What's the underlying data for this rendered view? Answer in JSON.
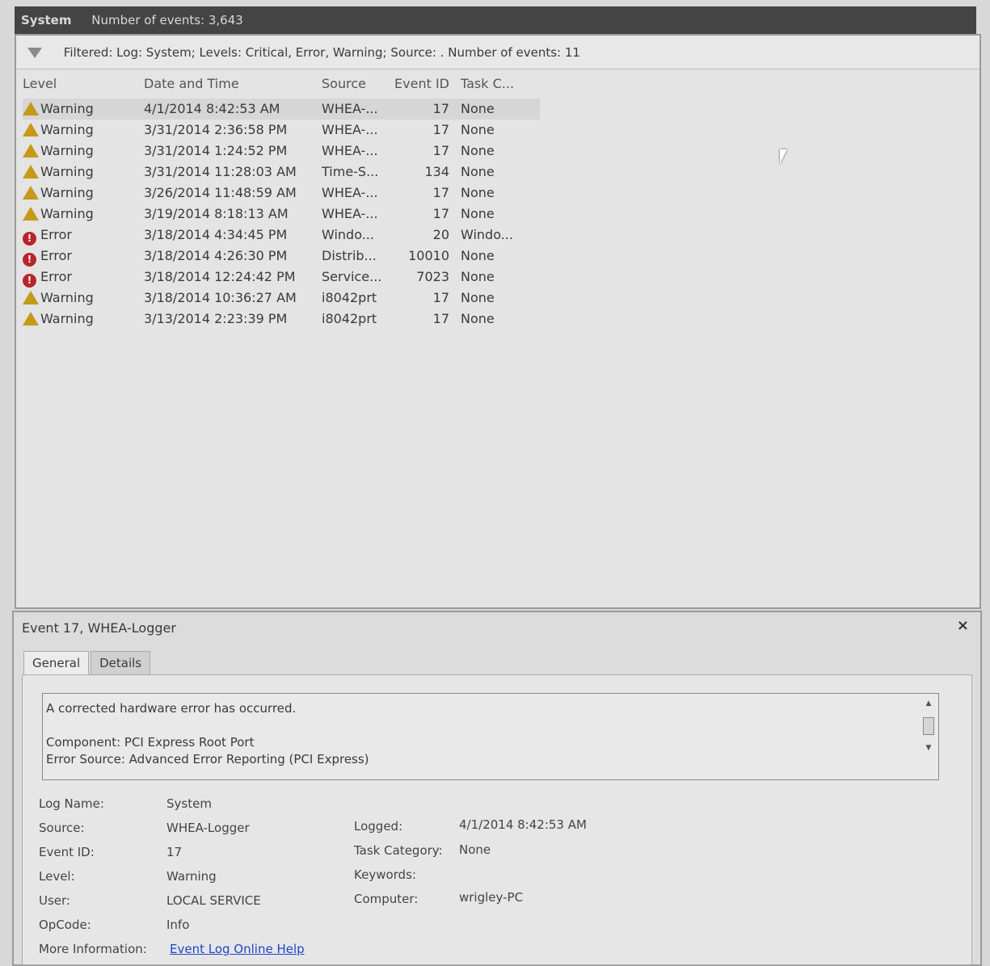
{
  "titlebar": {
    "name": "System",
    "count": "Number of events: 3,643"
  },
  "filter": {
    "text": "Filtered: Log: System; Levels: Critical, Error, Warning; Source: . Number of events: 11"
  },
  "columns": {
    "level": "Level",
    "date": "Date and Time",
    "source": "Source",
    "event_id": "Event ID",
    "task": "Task C..."
  },
  "events": [
    {
      "level": "Warning",
      "kind": "warning",
      "date": "4/1/2014 8:42:53 AM",
      "source": "WHEA-...",
      "id": "17",
      "task": "None"
    },
    {
      "level": "Warning",
      "kind": "warning",
      "date": "3/31/2014 2:36:58 PM",
      "source": "WHEA-...",
      "id": "17",
      "task": "None"
    },
    {
      "level": "Warning",
      "kind": "warning",
      "date": "3/31/2014 1:24:52 PM",
      "source": "WHEA-...",
      "id": "17",
      "task": "None"
    },
    {
      "level": "Warning",
      "kind": "warning",
      "date": "3/31/2014 11:28:03 AM",
      "source": "Time-S...",
      "id": "134",
      "task": "None"
    },
    {
      "level": "Warning",
      "kind": "warning",
      "date": "3/26/2014 11:48:59 AM",
      "source": "WHEA-...",
      "id": "17",
      "task": "None"
    },
    {
      "level": "Warning",
      "kind": "warning",
      "date": "3/19/2014 8:18:13 AM",
      "source": "WHEA-...",
      "id": "17",
      "task": "None"
    },
    {
      "level": "Error",
      "kind": "error",
      "date": "3/18/2014 4:34:45 PM",
      "source": "Windo...",
      "id": "20",
      "task": "Windo..."
    },
    {
      "level": "Error",
      "kind": "error",
      "date": "3/18/2014 4:26:30 PM",
      "source": "Distrib...",
      "id": "10010",
      "task": "None"
    },
    {
      "level": "Error",
      "kind": "error",
      "date": "3/18/2014 12:24:42 PM",
      "source": "Service...",
      "id": "7023",
      "task": "None"
    },
    {
      "level": "Warning",
      "kind": "warning",
      "date": "3/18/2014 10:36:27 AM",
      "source": "i8042prt",
      "id": "17",
      "task": "None"
    },
    {
      "level": "Warning",
      "kind": "warning",
      "date": "3/13/2014 2:23:39 PM",
      "source": "i8042prt",
      "id": "17",
      "task": "None"
    }
  ],
  "detail": {
    "title": "Event 17, WHEA-Logger",
    "close": "×",
    "tabs": {
      "general": "General",
      "details": "Details"
    },
    "description": {
      "line1": "A corrected hardware error has occurred.",
      "line2": "Component: PCI Express Root Port",
      "line3": "Error Source: Advanced Error Reporting (PCI Express)"
    },
    "labels": {
      "log_name": "Log Name:",
      "source": "Source:",
      "event_id": "Event ID:",
      "level": "Level:",
      "user": "User:",
      "opcode": "OpCode:",
      "more_info": "More Information:",
      "logged": "Logged:",
      "task_category": "Task Category:",
      "keywords": "Keywords:",
      "computer": "Computer:"
    },
    "values": {
      "log_name": "System",
      "source": "WHEA-Logger",
      "event_id": "17",
      "level": "Warning",
      "user": "LOCAL SERVICE",
      "opcode": "Info",
      "more_info": "Event Log Online Help",
      "logged": "4/1/2014 8:42:53 AM",
      "task_category": "None",
      "keywords": "",
      "computer": "wrigley-PC"
    }
  },
  "colors": {
    "warning": "#c49a18",
    "error": "#b7252a",
    "link": "#1e46c8"
  }
}
